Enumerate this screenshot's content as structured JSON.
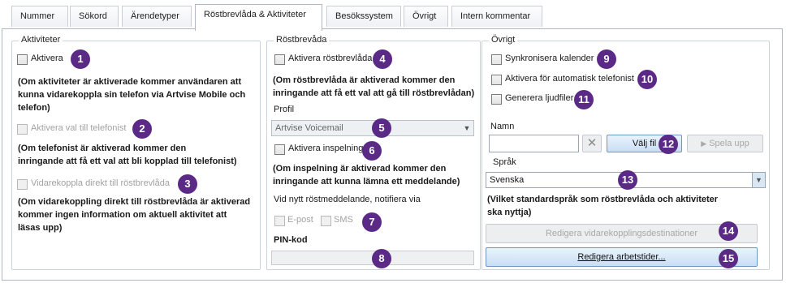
{
  "tabs": [
    "Nummer",
    "Sökord",
    "Ärendetyper",
    "Röstbrevlåda & Aktiviteter",
    "Besökssystem",
    "Övrigt",
    "Intern kommentar"
  ],
  "active_tab": "Röstbrevlåda & Aktiviteter",
  "activities": {
    "title": "Aktiviteter",
    "activate_label": "Aktivera",
    "activate_note_1": "(Om aktiviteter är aktiverade kommer användaren att",
    "activate_note_2": "kunna vidarekoppla sin telefon via Artvise Mobile och",
    "activate_note_3": "telefon)",
    "phonist_label": "Aktivera val till telefonist",
    "phonist_note_1": "(Om telefonist är aktiverad kommer den",
    "phonist_note_2": "inringande att få ett val att bli kopplad till telefonist)",
    "forward_label": "Vidarekoppla direkt till röstbrevlåda",
    "forward_note_1": "(Om vidarekoppling direkt till röstbrevlåda är aktiverad",
    "forward_note_2": "kommer ingen information om aktuell aktivitet att",
    "forward_note_3": "läsas upp)"
  },
  "voicemail": {
    "title": "Röstbrevåda",
    "activate_label": "Aktivera röstbrevlåda",
    "activate_note_1": "(Om röstbrevlåda är aktiverad kommer den",
    "activate_note_2": "inringande att få ett val att gå till röstbrevlådan)",
    "profile_label": "Profil",
    "profile_value": "Artvise Voicemail",
    "recording_label": "Aktivera inspelning",
    "recording_note_1": "(Om inspelning är aktiverad kommer den",
    "recording_note_2": "inringande att kunna lämna ett meddelande)",
    "notify_label": "Vid nytt röstmeddelande, notifiera via",
    "email_label": "E-post",
    "sms_label": "SMS",
    "pin_label": "PIN-kod"
  },
  "other": {
    "title": "Övrigt",
    "sync_label": "Synkronisera kalender",
    "auto_phonist_label": "Aktivera för automatisk telefonist",
    "generate_label": "Generera ljudfiler",
    "name_label": "Namn",
    "choose_file_label": "Välj fil",
    "play_label": "Spela upp",
    "language_label": "Språk",
    "language_value": "Svenska",
    "language_note_1": "(Vilket standardspråk som röstbrevlåda och aktiviteter",
    "language_note_2": "ska nyttja)",
    "edit_forward_label": "Redigera vidarekopplingsdestinationer",
    "edit_hours_label": "Redigera arbetstider..."
  },
  "badges": [
    "1",
    "2",
    "3",
    "4",
    "5",
    "6",
    "7",
    "8",
    "9",
    "10",
    "11",
    "12",
    "13",
    "14",
    "15"
  ],
  "colors": {
    "badge": "#5b2a86",
    "accent_border": "#6f95c2"
  },
  "icons": [
    "checkbox",
    "dropdown-arrow-icon",
    "clear-x-icon",
    "play-icon"
  ]
}
